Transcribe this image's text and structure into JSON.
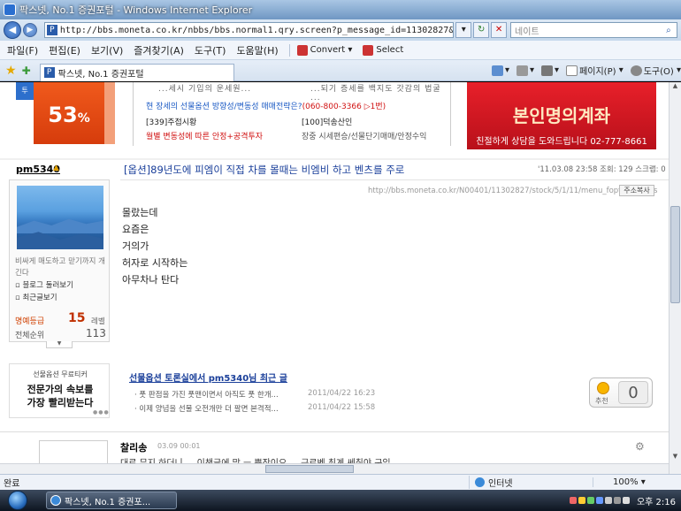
{
  "window": {
    "title": "팍스넷, No.1 증권포털 - Windows Internet Explorer"
  },
  "address_bar": {
    "favicon": "P",
    "url": "http://bbs.moneta.co.kr/nbbs/bbs.normal1.qry.screen?p_message_id=11302827&p_bbs_id=N00401&p",
    "search_placeholder": "네이트"
  },
  "menu": {
    "items": [
      "파일(F)",
      "편집(E)",
      "보기(V)",
      "즐겨찾기(A)",
      "도구(T)",
      "도움말(H)"
    ],
    "convert_label": "Convert",
    "select_label": "Select"
  },
  "tab": {
    "label": "팍스넷, No.1 증권포털",
    "page_label": "페이지(P)",
    "tools_label": "도구(O)"
  },
  "ads": {
    "percent": "53",
    "percent_sign": "%",
    "left_tag": "투",
    "mid_cut_left": "...세시 기입의 운세원...",
    "mid_cut_right": "...되기 증세를 백지도 갓감의 법굴 ...",
    "mid_line1_prefix": "현 장세의 선물옵션 방향성/변동성 매매전략은?",
    "mid_line1_phone": "(060-800-3366 ▷1번)",
    "mid_line2a": "[339]주접시황",
    "mid_line2b": "[100]덕송산인",
    "mid_line3a": "월별 변동성에 따른 안정+공격투자",
    "mid_line3b": "장중 시세편승/선물단기매매/안정수익",
    "red_big": "본인명의계좌",
    "red_small": "친절하게 상담을 도와드립니다 02-777-8661"
  },
  "user": {
    "name": "pm5340",
    "bio": "비싸게 매도하고 맏기까지 개긴다",
    "link1": "블로그 둘러보기",
    "link2": "최근글보기",
    "level_label": "명예등급",
    "level_value": "15",
    "level_unit": "레벨",
    "rank_label": "전체순위",
    "rank_value": "113"
  },
  "post": {
    "title": "[옵션]89년도에 피엠이 직접 차를 몰때는 비엠비 하고 벤츠를 주로",
    "meta": "'11.03.08 23:58  조회: 129  스크랩: 0",
    "url": "http://bbs.moneta.co.kr/N00401/11302827/stock/5/1/11/menu_foptionchams",
    "copy_label": "주소복사",
    "body_lines": [
      "몰랐는데",
      "요즘은",
      "거의가",
      "허자로 시작하는",
      "아무차나 탄다"
    ]
  },
  "ad2": {
    "line1": "선물옵션 무료티커",
    "line2": "전문가의 속보를",
    "line3": "가장 빨리받는다"
  },
  "recent": {
    "title": "선물옵션 토론실에서 pm5340님 최근 글",
    "items": [
      {
        "text": "풋 판점을 가진 풋맨이면서 아직도 풋 한개...",
        "date": "2011/04/22 16:23"
      },
      {
        "text": "이제 양념을 선물 오전개만 더 팔면 본격적...",
        "date": "2011/04/22 15:58"
      }
    ]
  },
  "recommend": {
    "label": "추천",
    "count": "0"
  },
  "next_post": {
    "user": "찰리송",
    "date": "03.09 00:01",
    "body": "대로 무지 하더니 ... 이챈글에 맘 ㅡ 뿐장이오 ... 근로벤 최계 쎄취야 구입 ..."
  },
  "status": {
    "text": "완료",
    "zone": "인터넷",
    "zoom": "100%"
  },
  "taskbar": {
    "window_button": "팍스넷, No.1 증권포...",
    "clock": "오후 2:16"
  }
}
